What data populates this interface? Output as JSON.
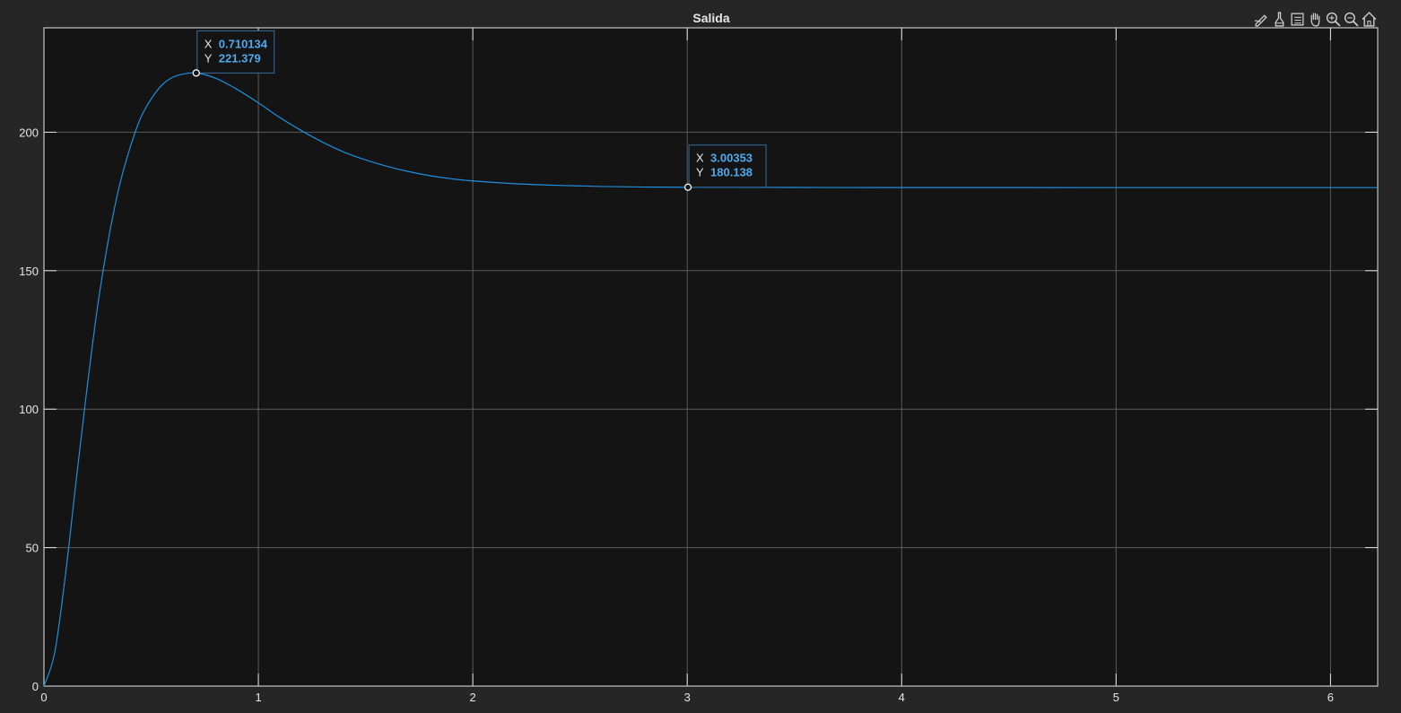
{
  "toolbar": {
    "icons": [
      "edit-figure-icon",
      "brush-icon",
      "legend-icon",
      "pan-icon",
      "zoom-in-icon",
      "zoom-out-icon",
      "home-icon"
    ]
  },
  "colors": {
    "background": "#262626",
    "axes_background": "#141414",
    "line": "#1f8fe0",
    "grid": "#5a5a5a",
    "tick_text": "#e6e6e6",
    "datatip_value": "#4fa9ec"
  },
  "chart_data": {
    "type": "line",
    "title": "Salida",
    "xlabel": "",
    "ylabel": "",
    "xlim": [
      0,
      6.22
    ],
    "ylim": [
      0,
      237.7
    ],
    "grid": true,
    "x_ticks": [
      "0",
      "1",
      "2",
      "3",
      "4",
      "5",
      "6"
    ],
    "y_ticks": [
      "0",
      "50",
      "100",
      "150",
      "200"
    ],
    "series": [
      {
        "x": [
          0,
          0.05,
          0.1,
          0.15,
          0.2,
          0.25,
          0.3,
          0.35,
          0.4,
          0.45,
          0.5,
          0.55,
          0.6,
          0.65,
          0.71,
          0.8,
          0.9,
          1.0,
          1.1,
          1.2,
          1.3,
          1.4,
          1.5,
          1.6,
          1.7,
          1.8,
          1.9,
          2.0,
          2.2,
          2.4,
          2.6,
          2.8,
          3.0,
          3.5,
          4.0,
          5.0,
          6.22
        ],
        "y": [
          0,
          12,
          40,
          74,
          107,
          137,
          161,
          180,
          194,
          205,
          212,
          217,
          219.8,
          221,
          221.379,
          219.5,
          215.5,
          210.6,
          205.3,
          200.6,
          196.4,
          192.8,
          190,
          187.7,
          185.8,
          184.3,
          183.2,
          182.4,
          181.4,
          180.8,
          180.4,
          180.2,
          180.138,
          180.05,
          180.02,
          180,
          180
        ]
      }
    ],
    "datatips": [
      {
        "x_label": "X",
        "x_value": "0.710134",
        "y_label": "Y",
        "y_value": "221.379",
        "x": 0.710134,
        "y": 221.379
      },
      {
        "x_label": "X",
        "x_value": "3.00353",
        "y_label": "Y",
        "y_value": "180.138",
        "x": 3.00353,
        "y": 180.138
      }
    ]
  }
}
